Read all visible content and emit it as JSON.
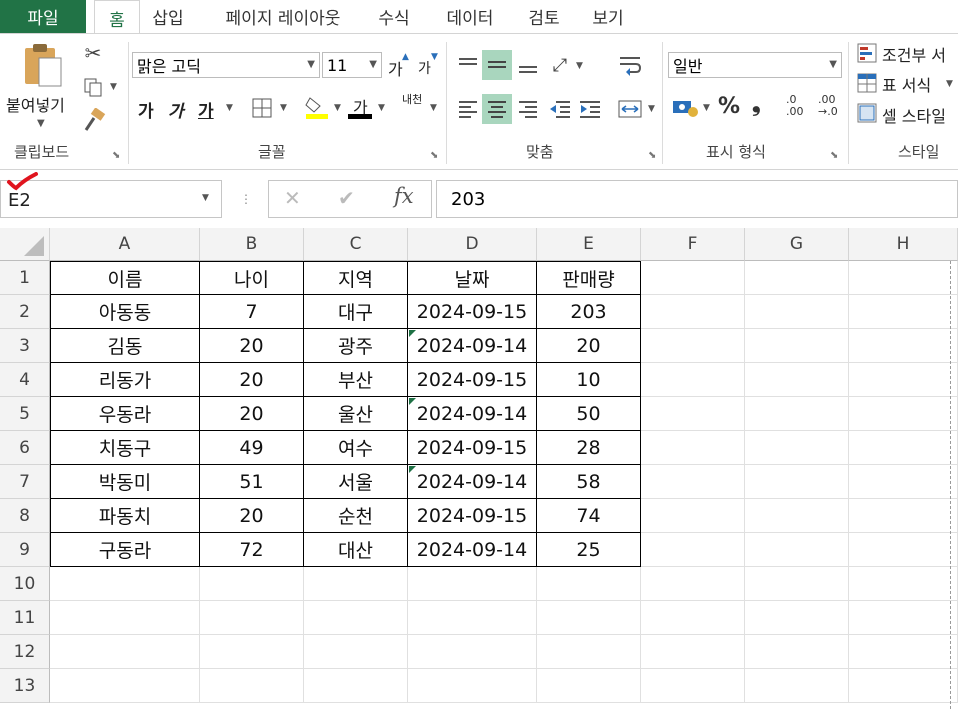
{
  "tabs": {
    "file": "파일",
    "items": [
      "홈",
      "삽입",
      "페이지 레이아웃",
      "수식",
      "데이터",
      "검토",
      "보기"
    ]
  },
  "ribbon": {
    "clipboard": {
      "paste": "붙여넣기",
      "label": "클립보드"
    },
    "font": {
      "name": "맑은 고딕",
      "size": "11",
      "grow": "가",
      "shrink": "가",
      "bold": "가",
      "italic": "가",
      "underline": "가",
      "color_letter": "가",
      "phonetic": "내천",
      "label": "글꼴"
    },
    "alignment": {
      "label": "맞춤"
    },
    "number": {
      "format": "일반",
      "percent": "%",
      "comma": "❟",
      "label": "표시 형식",
      "inc_decimal": ".0 .00",
      "dec_decimal": ".00 →.0"
    },
    "styles": {
      "conditional": "조건부 서",
      "table": "표 서식",
      "cell": "셀 스타일",
      "label": "스타일"
    }
  },
  "formula_bar": {
    "name_box": "E2",
    "cancel": "✕",
    "enter": "✔",
    "fx": "fx",
    "value": "203"
  },
  "columns": [
    "A",
    "B",
    "C",
    "D",
    "E",
    "F",
    "G",
    "H"
  ],
  "rows": [
    "1",
    "2",
    "3",
    "4",
    "5",
    "6",
    "7",
    "8",
    "9",
    "10",
    "11",
    "12",
    "13"
  ],
  "table": {
    "header": [
      "이름",
      "나이",
      "지역",
      "날짜",
      "판매량"
    ],
    "data": [
      [
        "아동동",
        "7",
        "대구",
        "2024-09-15",
        "203"
      ],
      [
        "김동",
        "20",
        "광주",
        "2024-09-14",
        "20"
      ],
      [
        "리동가",
        "20",
        "부산",
        "2024-09-15",
        "10"
      ],
      [
        "우동라",
        "20",
        "울산",
        "2024-09-14",
        "50"
      ],
      [
        "치동구",
        "49",
        "여수",
        "2024-09-15",
        "28"
      ],
      [
        "박동미",
        "51",
        "서울",
        "2024-09-14",
        "58"
      ],
      [
        "파동치",
        "20",
        "순천",
        "2024-09-15",
        "74"
      ],
      [
        "구동라",
        "72",
        "대산",
        "2024-09-14",
        "25"
      ]
    ],
    "text_marked_rows": [
      1,
      3,
      5
    ]
  },
  "colors": {
    "accent": "#217346",
    "selected_align": "#a9d6be",
    "red_mark": "#e0141e"
  }
}
